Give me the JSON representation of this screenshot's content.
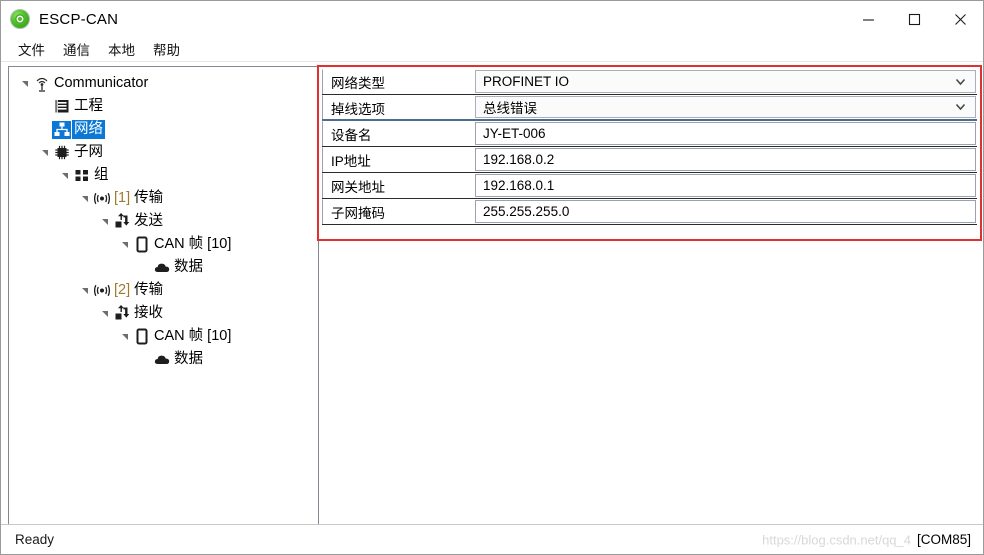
{
  "window": {
    "title": "ESCP-CAN",
    "app_icon": "green-gear-icon",
    "minimize_label": "—",
    "maximize_label": "□",
    "close_label": "✕"
  },
  "menubar": {
    "items": [
      {
        "label": "文件",
        "name": "menu-file"
      },
      {
        "label": "通信",
        "name": "menu-communication"
      },
      {
        "label": "本地",
        "name": "menu-local"
      },
      {
        "label": "帮助",
        "name": "menu-help"
      }
    ]
  },
  "tree": {
    "nodes": [
      {
        "label": "Communicator",
        "icon": "antenna-icon",
        "depth": 0,
        "twisty": "expanded",
        "selected": false
      },
      {
        "label": "工程",
        "icon": "project-icon",
        "depth": 1,
        "twisty": "none",
        "selected": false
      },
      {
        "label": "网络",
        "icon": "network-icon",
        "depth": 1,
        "twisty": "none",
        "selected": true
      },
      {
        "label": "子网",
        "icon": "chip-icon",
        "depth": 1,
        "twisty": "expanded",
        "selected": false
      },
      {
        "label": "组",
        "icon": "group-grid-icon",
        "depth": 2,
        "twisty": "expanded",
        "selected": false
      },
      {
        "label": "[1] 传输",
        "idx": "[1]",
        "text": " 传输",
        "icon": "broadcast-icon",
        "depth": 3,
        "twisty": "expanded",
        "selected": false
      },
      {
        "label": "发送",
        "icon": "transfer-icon",
        "depth": 4,
        "twisty": "expanded",
        "selected": false
      },
      {
        "label": "CAN 帧 [10]",
        "icon": "frame-icon",
        "depth": 5,
        "twisty": "expanded",
        "selected": false
      },
      {
        "label": "数据",
        "icon": "cloud-icon",
        "depth": 6,
        "twisty": "none",
        "selected": false
      },
      {
        "label": "[2] 传输",
        "idx": "[2]",
        "text": " 传输",
        "icon": "broadcast-icon",
        "depth": 3,
        "twisty": "expanded",
        "selected": false
      },
      {
        "label": "接收",
        "icon": "transfer-icon",
        "depth": 4,
        "twisty": "expanded",
        "selected": false
      },
      {
        "label": "CAN 帧 [10]",
        "icon": "frame-icon",
        "depth": 5,
        "twisty": "expanded",
        "selected": false
      },
      {
        "label": "数据",
        "icon": "cloud-icon",
        "depth": 6,
        "twisty": "none",
        "selected": false
      }
    ]
  },
  "form": {
    "border_color": "#e03030",
    "rows": [
      {
        "label": "网络类型",
        "value": "PROFINET IO",
        "type": "combo",
        "name": "network-type"
      },
      {
        "label": "掉线选项",
        "value": "总线错误",
        "type": "combo",
        "name": "offline-option"
      },
      {
        "label": "设备名",
        "value": "JY-ET-006",
        "type": "text",
        "name": "device-name"
      },
      {
        "label": "IP地址",
        "value": "192.168.0.2",
        "type": "text",
        "name": "ip-address"
      },
      {
        "label": "网关地址",
        "value": "192.168.0.1",
        "type": "text",
        "name": "gateway-address"
      },
      {
        "label": "子网掩码",
        "value": "255.255.255.0",
        "type": "text",
        "name": "subnet-mask"
      }
    ]
  },
  "statusbar": {
    "status": "Ready",
    "port": "[COM85]",
    "watermark": "https://blog.csdn.net/qq_4"
  }
}
